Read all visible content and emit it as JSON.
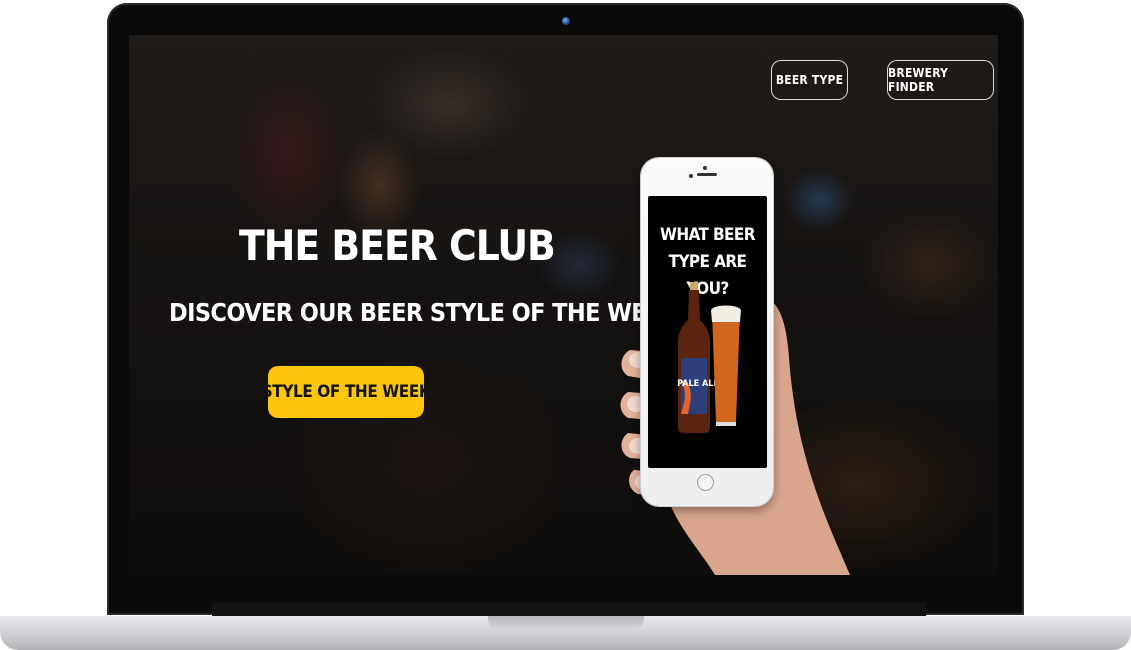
{
  "nav": {
    "beer_type_label": "BEER TYPE",
    "brewery_finder_label": "BREWERY FINDER"
  },
  "hero": {
    "title": "THE BEER CLUB",
    "subtitle": "DISCOVER OUR BEER STYLE OF THE WEEK",
    "cta_label": "STYLE OF THE WEEK"
  },
  "phone": {
    "headline": "WHAT BEER TYPE ARE YOU?",
    "bottle_label": "PALE ALE"
  },
  "colors": {
    "cta": "#fdc60a",
    "screen_bg": "#1d1a18"
  }
}
